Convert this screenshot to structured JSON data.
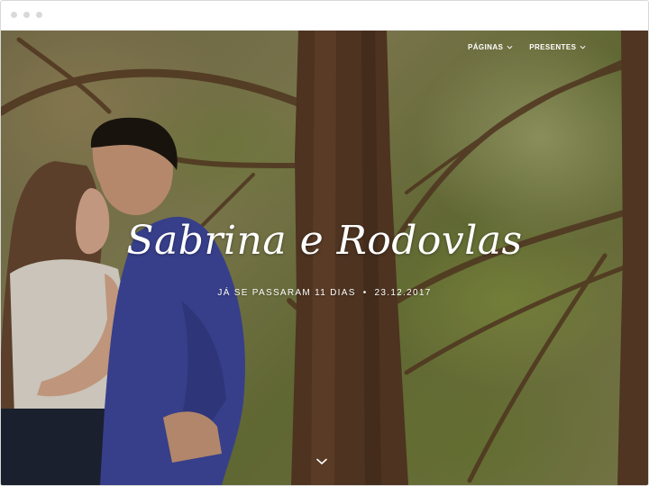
{
  "nav": {
    "items": [
      {
        "label": "Páginas"
      },
      {
        "label": "Presentes"
      }
    ]
  },
  "hero": {
    "title": "Sabrina e Rodovlas",
    "days_text": "Já se passaram 11 dias",
    "separator": "•",
    "date": "23.12.2017"
  },
  "icons": {
    "nav_dropdown": "chevron-down-icon",
    "scroll": "chevron-down-icon"
  },
  "colors": {
    "text": "#ffffff",
    "shirt": "#3f4aa8",
    "bark": "#5a3a25",
    "foliage": "#7b8a3e"
  }
}
